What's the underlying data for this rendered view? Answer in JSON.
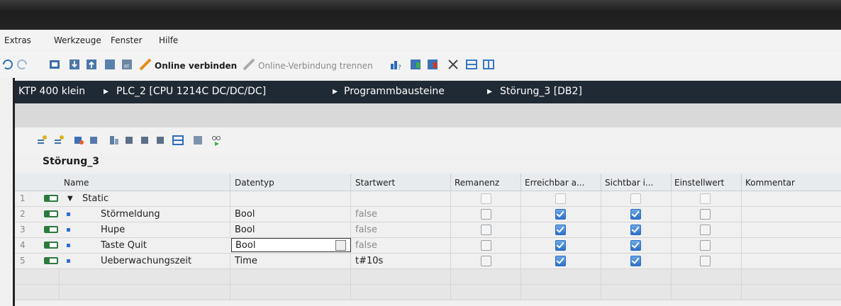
{
  "menu": [
    "Extras",
    "Werkzeuge",
    "Fenster",
    "Hilfe"
  ],
  "toolbar": {
    "online_connect": "Online verbinden",
    "online_disconnect": "Online-Verbindung trennen"
  },
  "breadcrumb": [
    "KTP 400 klein",
    "PLC_2 [CPU 1214C DC/DC/DC]",
    "Programmbausteine",
    "Störung_3 [DB2]"
  ],
  "breadcrumb_sep": "▸",
  "db": {
    "name": "Störung_3"
  },
  "table": {
    "headers": [
      "Name",
      "Datentyp",
      "Startwert",
      "Remanenz",
      "Erreichbar a...",
      "Sichtbar i...",
      "Einstellwert",
      "Kommentar"
    ],
    "rows": [
      {
        "num": "1",
        "name": "Static",
        "type": "",
        "start": "",
        "remanenz": false,
        "erreichbar": false,
        "sichtbar": false,
        "einstell": false,
        "disabled": true
      },
      {
        "num": "2",
        "name": "Störmeldung",
        "type": "Bool",
        "start": "false",
        "remanenz": false,
        "erreichbar": true,
        "sichtbar": true,
        "einstell": false
      },
      {
        "num": "3",
        "name": "Hupe",
        "type": "Bool",
        "start": "false",
        "remanenz": false,
        "erreichbar": true,
        "sichtbar": true,
        "einstell": false
      },
      {
        "num": "4",
        "name": "Taste Quit",
        "type": "Bool",
        "start": "false",
        "remanenz": false,
        "erreichbar": true,
        "sichtbar": true,
        "einstell": false
      },
      {
        "num": "5",
        "name": "Ueberwachungszeit",
        "type": "Time",
        "start": "t#10s",
        "remanenz": false,
        "erreichbar": true,
        "sichtbar": true,
        "einstell": false
      }
    ]
  },
  "colors": {
    "path_bg": "#202a34",
    "accent": "#2e6fcb"
  }
}
